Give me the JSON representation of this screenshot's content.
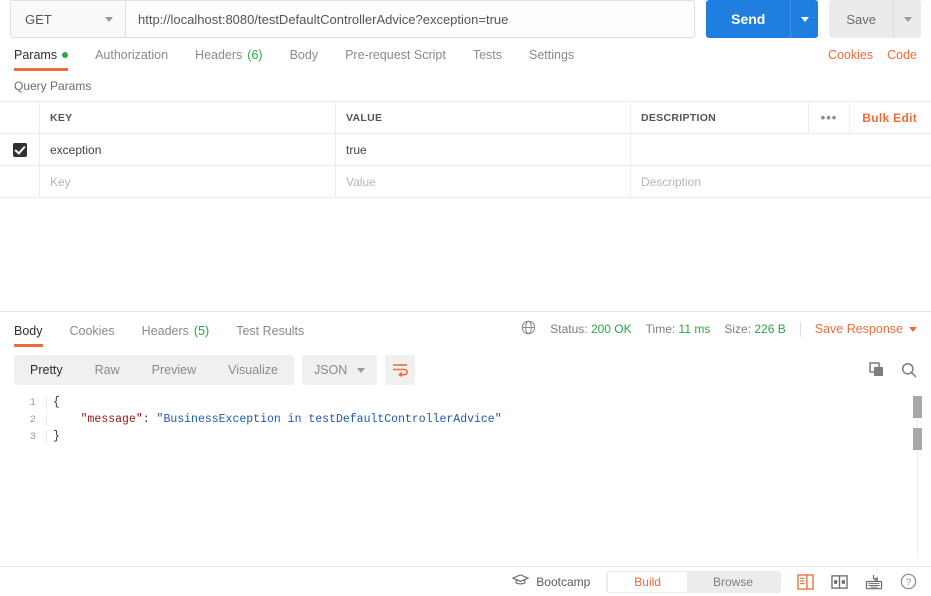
{
  "request": {
    "method": "GET",
    "url": "http://localhost:8080/testDefaultControllerAdvice?exception=true",
    "send_label": "Send",
    "save_label": "Save",
    "tabs": [
      {
        "label": "Params",
        "badge": "",
        "dot": true,
        "active": true
      },
      {
        "label": "Authorization",
        "badge": "",
        "dot": false,
        "active": false
      },
      {
        "label": "Headers",
        "badge": "(6)",
        "dot": false,
        "active": false
      },
      {
        "label": "Body",
        "badge": "",
        "dot": false,
        "active": false
      },
      {
        "label": "Pre-request Script",
        "badge": "",
        "dot": false,
        "active": false
      },
      {
        "label": "Tests",
        "badge": "",
        "dot": false,
        "active": false
      },
      {
        "label": "Settings",
        "badge": "",
        "dot": false,
        "active": false
      }
    ],
    "cookies_link": "Cookies",
    "code_link": "Code"
  },
  "query_params": {
    "title": "Query Params",
    "columns": {
      "key": "KEY",
      "value": "VALUE",
      "description": "DESCRIPTION"
    },
    "bulk_edit_label": "Bulk Edit",
    "more_label": "•••",
    "rows": [
      {
        "checked": true,
        "key": "exception",
        "value": "true",
        "description": "",
        "placeholder": false
      },
      {
        "checked": false,
        "key": "Key",
        "value": "Value",
        "description": "Description",
        "placeholder": true
      }
    ]
  },
  "response": {
    "tabs": [
      {
        "label": "Body",
        "badge": "",
        "active": true
      },
      {
        "label": "Cookies",
        "badge": "",
        "active": false
      },
      {
        "label": "Headers",
        "badge": "(5)",
        "active": false
      },
      {
        "label": "Test Results",
        "badge": "",
        "active": false
      }
    ],
    "status_label": "Status:",
    "status_value": "200 OK",
    "time_label": "Time:",
    "time_value": "11 ms",
    "size_label": "Size:",
    "size_value": "226 B",
    "save_response_label": "Save Response",
    "view_modes": [
      {
        "label": "Pretty",
        "active": true
      },
      {
        "label": "Raw",
        "active": false
      },
      {
        "label": "Preview",
        "active": false
      },
      {
        "label": "Visualize",
        "active": false
      }
    ],
    "format": "JSON",
    "body_lines": [
      {
        "n": "1",
        "indent": "",
        "key": "",
        "sep": "",
        "value": "",
        "punc": "{"
      },
      {
        "n": "2",
        "indent": "    ",
        "key": "\"message\"",
        "sep": ": ",
        "value": "\"BusinessException in testDefaultControllerAdvice\"",
        "punc": ""
      },
      {
        "n": "3",
        "indent": "",
        "key": "",
        "sep": "",
        "value": "",
        "punc": "}"
      }
    ]
  },
  "footer": {
    "bootcamp_label": "Bootcamp",
    "build_label": "Build",
    "browse_label": "Browse"
  },
  "colors": {
    "accent_orange": "#ef6b38",
    "send_blue": "#1e7fe0",
    "status_green": "#2aa745"
  }
}
